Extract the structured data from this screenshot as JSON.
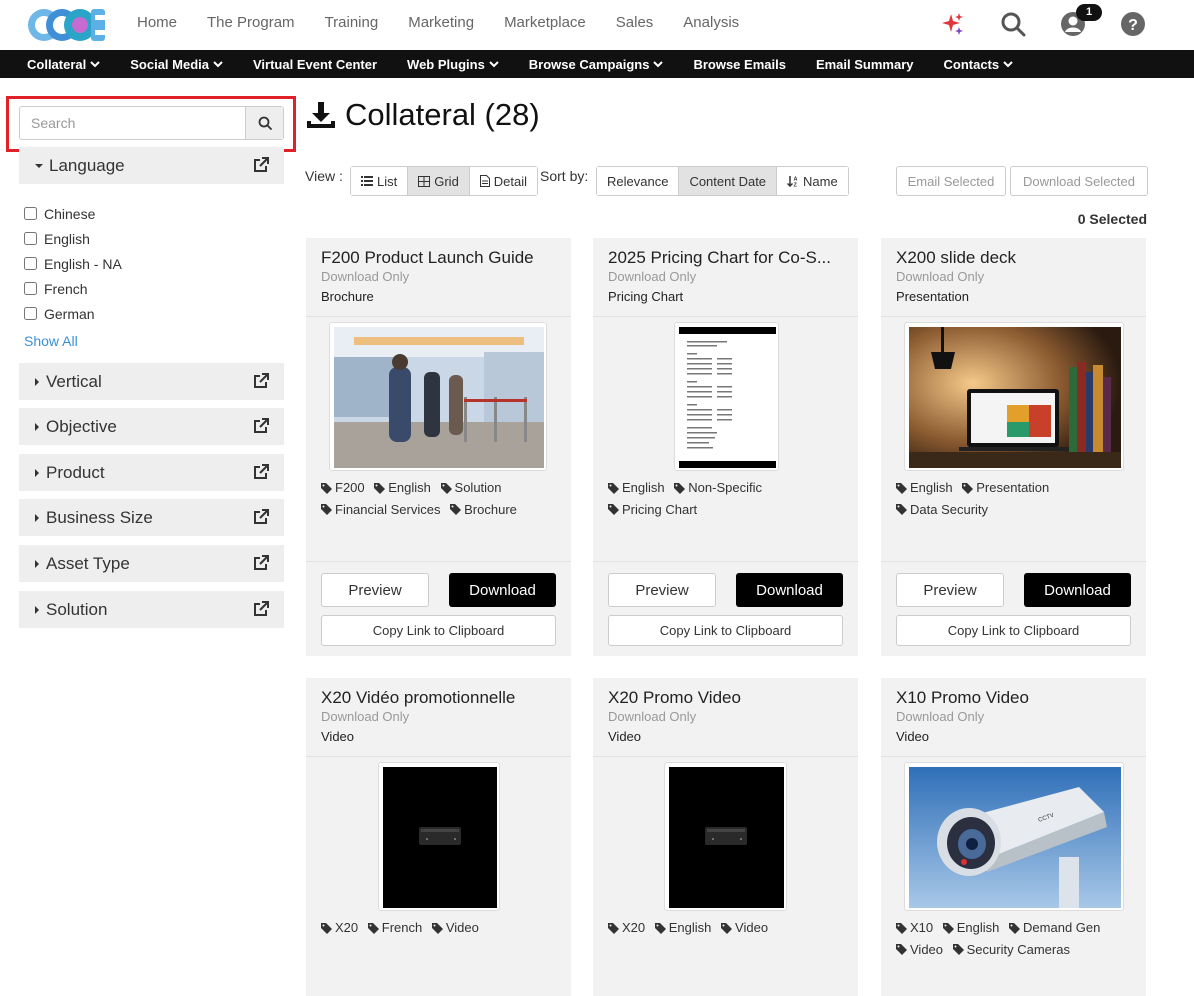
{
  "topnav": {
    "logo_text": "CCOE",
    "items": [
      "Home",
      "The Program",
      "Training",
      "Marketing",
      "Marketplace",
      "Sales",
      "Analysis"
    ],
    "notification_count": "1"
  },
  "subnav": {
    "items": [
      {
        "label": "Collateral",
        "dropdown": true
      },
      {
        "label": "Social Media",
        "dropdown": true
      },
      {
        "label": "Virtual Event Center",
        "dropdown": false
      },
      {
        "label": "Web Plugins",
        "dropdown": true
      },
      {
        "label": "Browse Campaigns",
        "dropdown": true
      },
      {
        "label": "Browse Emails",
        "dropdown": false
      },
      {
        "label": "Email Summary",
        "dropdown": false
      },
      {
        "label": "Contacts",
        "dropdown": true
      }
    ]
  },
  "sidebar": {
    "search_placeholder": "Search",
    "language": {
      "label": "Language",
      "options": [
        "Chinese",
        "English",
        "English - NA",
        "French",
        "German"
      ],
      "show_all": "Show All"
    },
    "facets": [
      "Vertical",
      "Objective",
      "Product",
      "Business Size",
      "Asset Type",
      "Solution"
    ]
  },
  "main": {
    "title": "Collateral (28)",
    "view_label": "View :",
    "view_options": [
      "List",
      "Grid",
      "Detail"
    ],
    "view_selected": "Grid",
    "sort_label": "Sort by:",
    "sort_options": [
      "Relevance",
      "Content Date",
      "Name"
    ],
    "sort_selected": "Content Date",
    "email_selected": "Email Selected",
    "download_selected": "Download Selected",
    "selected_count": "0 Selected"
  },
  "card_labels": {
    "preview": "Preview",
    "download": "Download",
    "copy_link": "Copy Link to Clipboard"
  },
  "cards": [
    {
      "title": "F200 Product Launch Guide",
      "subtitle": "Download Only",
      "type": "Brochure",
      "tags": [
        "F200",
        "English",
        "Solution",
        "Financial Services",
        "Brochure"
      ],
      "thumb": "airport-photo"
    },
    {
      "title": "2025 Pricing Chart for Co-S...",
      "subtitle": "Download Only",
      "type": "Pricing Chart",
      "tags": [
        "English",
        "Non-Specific",
        "Pricing Chart"
      ],
      "thumb": "document"
    },
    {
      "title": "X200 slide deck",
      "subtitle": "Download Only",
      "type": "Presentation",
      "tags": [
        "English",
        "Presentation",
        "Data Security"
      ],
      "thumb": "laptop-photo"
    },
    {
      "title": "X20 Vidéo promotionnelle",
      "subtitle": "Download Only",
      "type": "Video",
      "tags": [
        "X20",
        "French",
        "Video"
      ],
      "thumb": "video"
    },
    {
      "title": "X20 Promo Video",
      "subtitle": "Download Only",
      "type": "Video",
      "tags": [
        "X20",
        "English",
        "Video"
      ],
      "thumb": "video"
    },
    {
      "title": "X10 Promo Video",
      "subtitle": "Download Only",
      "type": "Video",
      "tags": [
        "X10",
        "English",
        "Demand Gen",
        "Video",
        "Security Cameras"
      ],
      "thumb": "camera-photo"
    }
  ],
  "colors": {
    "highlight_red": "#e02127",
    "subnav_bg": "#111111",
    "link_blue": "#3a8fd9",
    "card_bg": "#f2f2f2"
  }
}
